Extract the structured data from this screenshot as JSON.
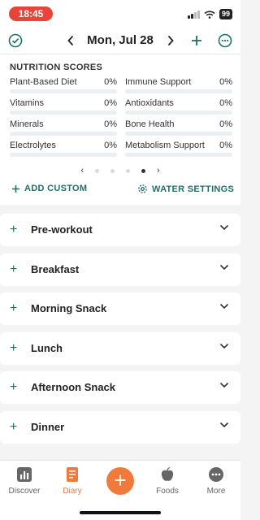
{
  "status": {
    "time": "18:45",
    "battery": "99"
  },
  "header": {
    "date": "Mon, Jul 28"
  },
  "scores": {
    "title": "NUTRITION SCORES",
    "items": [
      {
        "name": "Plant-Based Diet",
        "pct": "0%",
        "value": 0
      },
      {
        "name": "Immune Support",
        "pct": "0%",
        "value": 0
      },
      {
        "name": "Vitamins",
        "pct": "0%",
        "value": 0
      },
      {
        "name": "Antioxidants",
        "pct": "0%",
        "value": 0
      },
      {
        "name": "Minerals",
        "pct": "0%",
        "value": 0
      },
      {
        "name": "Bone Health",
        "pct": "0%",
        "value": 0
      },
      {
        "name": "Electrolytes",
        "pct": "0%",
        "value": 0
      },
      {
        "name": "Metabolism Support",
        "pct": "0%",
        "value": 0
      }
    ],
    "pager": {
      "prev": "‹",
      "next": "›"
    }
  },
  "actions": {
    "add_custom": "ADD CUSTOM",
    "water_settings": "WATER SETTINGS"
  },
  "meals": [
    {
      "label": "Pre-workout"
    },
    {
      "label": "Breakfast"
    },
    {
      "label": "Morning Snack"
    },
    {
      "label": "Lunch"
    },
    {
      "label": "Afternoon Snack"
    },
    {
      "label": "Dinner"
    }
  ],
  "tabs": {
    "discover": "Discover",
    "diary": "Diary",
    "foods": "Foods",
    "more": "More"
  },
  "colors": {
    "accent": "#1f6f6b",
    "brand": "#f07a3c",
    "time_pill": "#e8443a"
  }
}
